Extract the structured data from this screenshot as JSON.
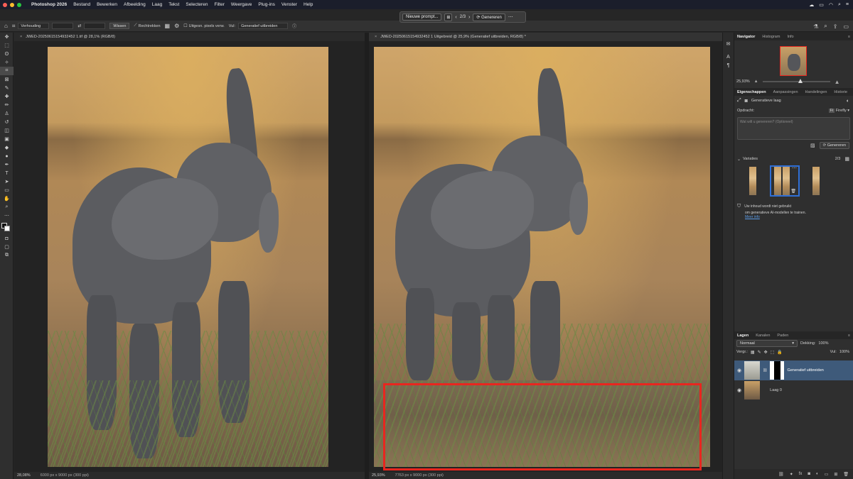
{
  "menubar": {
    "app": "Photoshop 2026",
    "items": [
      "Bestand",
      "Bewerken",
      "Afbeelding",
      "Laag",
      "Tekst",
      "Selecteren",
      "Filter",
      "Weergave",
      "Plug-ins",
      "Venster",
      "Help"
    ]
  },
  "taskbar": {
    "prompt": "Nieuwe prompt...",
    "counter": "2/3",
    "generate": "Genereren"
  },
  "options": {
    "ratio": "Verhouding",
    "clear": "Wissen",
    "straighten": "Rechtrekken",
    "extend_label": "Uitgesn. pixels verw.",
    "fill_label": "Vul:",
    "fill_value": "Generatief uitbreiden"
  },
  "docs": {
    "left": {
      "tab": "JWED-20250615154932452 1.tif @ 28,1% (RGB/8)",
      "zoom": "28,08%",
      "info": "6000 px x 9000 px (300 ppi)"
    },
    "right": {
      "tab": "JWED-20250615154932452 1 Uitgebreid @ 25,9% (Generatief uitbreiden, RGB/8) *",
      "zoom": "25,93%",
      "info": "7763 px x 9000 px (300 ppi)"
    }
  },
  "navigator": {
    "tabs": [
      "Navigator",
      "Histogram",
      "Info"
    ],
    "zoom": "25,93%"
  },
  "properties": {
    "tabs": [
      "Eigenschappen",
      "Aanpassingen",
      "Handelingen",
      "Historie"
    ],
    "layer_type": "Generatieve laag",
    "prompt_label": "Opdracht:",
    "model": "Firefly",
    "prompt_placeholder": "Wat wilt u genereren? (Optioneel)",
    "generate": "Genereren",
    "variations_label": "Variaties",
    "variations_count": "2/3",
    "notice_line1": "Uw inhoud wordt niet gebruikt",
    "notice_line2": "om generatieve AI-modellen te trainen.",
    "more_info": "Meer info"
  },
  "layers": {
    "tabs": [
      "Lagen",
      "Kanalen",
      "Paden"
    ],
    "blend_mode": "Normaal",
    "opacity_label": "Dekking:",
    "opacity": "100%",
    "lock_label": "Vergr.:",
    "fill_label": "Vul:",
    "fill": "100%",
    "items": [
      {
        "name": "Generatief uitbreiden",
        "selected": true
      },
      {
        "name": "Laag 0",
        "selected": false
      }
    ]
  },
  "colors": {
    "accent": "#2f6fd6",
    "highlight_box": "#e8261f",
    "selected_layer": "#3e5a7a"
  }
}
